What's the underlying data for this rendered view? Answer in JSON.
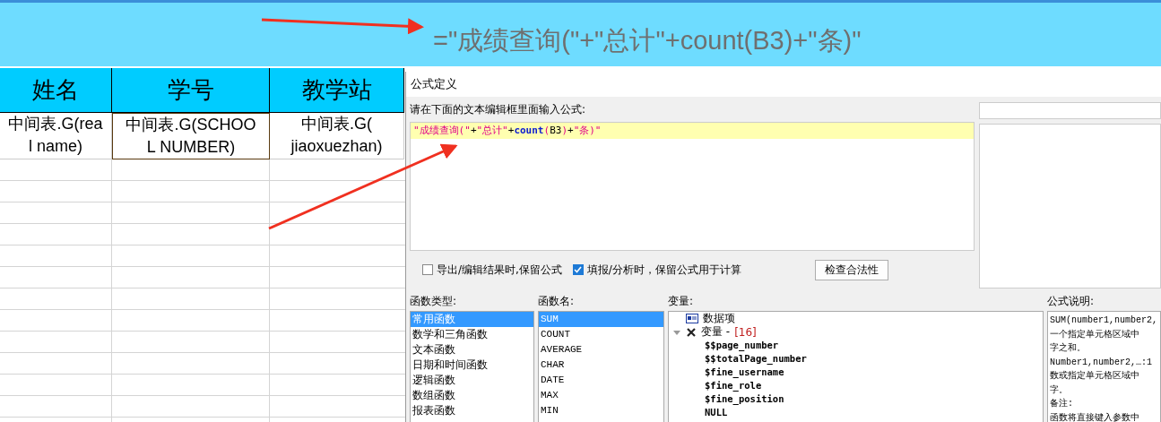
{
  "banner": {
    "formula": "=\"成绩查询(\"+\"总计\"+count(B3)+\"条)\""
  },
  "sheet": {
    "columns": [
      "姓名",
      "学号",
      "教学站"
    ],
    "rows": [
      [
        {
          "text": "中间表.G(rea\nl name)",
          "selected": false
        },
        {
          "text": "中间表.G(SCHOO\nL NUMBER)",
          "selected": true
        },
        {
          "text": "中间表.G(\njiaoxuezhan)",
          "selected": false
        }
      ]
    ]
  },
  "dialog": {
    "title": "公式定义",
    "editor_label": "请在下面的文本编辑框里面输入公式:",
    "formula_tokens": [
      {
        "kind": "string",
        "text": "\"成绩查询(\""
      },
      {
        "kind": "operator",
        "text": "+"
      },
      {
        "kind": "string",
        "text": "\"总计\""
      },
      {
        "kind": "operator",
        "text": "+"
      },
      {
        "kind": "function",
        "text": "count"
      },
      {
        "kind": "paren",
        "text": "("
      },
      {
        "kind": "ref",
        "text": "B3"
      },
      {
        "kind": "paren",
        "text": ")"
      },
      {
        "kind": "operator",
        "text": "+"
      },
      {
        "kind": "string",
        "text": "\"条)\""
      }
    ],
    "options": [
      {
        "label": "导出/编辑结果时,保留公式",
        "checked": false
      },
      {
        "label": "填报/分析时，保留公式用于计算",
        "checked": true
      }
    ],
    "check_button": "检查合法性",
    "function_types": {
      "label": "函数类型:",
      "items": [
        {
          "text": "常用函数",
          "selected": true
        },
        {
          "text": "数学和三角函数",
          "selected": false
        },
        {
          "text": "文本函数",
          "selected": false
        },
        {
          "text": "日期和时间函数",
          "selected": false
        },
        {
          "text": "逻辑函数",
          "selected": false
        },
        {
          "text": "数组函数",
          "selected": false
        },
        {
          "text": "报表函数",
          "selected": false
        }
      ]
    },
    "function_names": {
      "label": "函数名:",
      "items": [
        {
          "text": "SUM",
          "selected": true
        },
        {
          "text": "COUNT",
          "selected": false
        },
        {
          "text": "AVERAGE",
          "selected": false
        },
        {
          "text": "CHAR",
          "selected": false
        },
        {
          "text": "DATE",
          "selected": false
        },
        {
          "text": "MAX",
          "selected": false
        },
        {
          "text": "MIN",
          "selected": false
        }
      ]
    },
    "variables": {
      "label": "变量:",
      "tree": [
        {
          "kind": "dataset",
          "label": "数据项",
          "expanded": false
        },
        {
          "kind": "group",
          "label": "变量 -",
          "count": "[16]",
          "expanded": true,
          "children": [
            {
              "label": "$$page_number"
            },
            {
              "label": "$$totalPage_number"
            },
            {
              "label": "$fine_username"
            },
            {
              "label": "$fine_role"
            },
            {
              "label": "$fine_position"
            },
            {
              "label": "NULL"
            }
          ]
        }
      ]
    },
    "description": {
      "label": "公式说明:",
      "lines": [
        "SUM(number1,number2,",
        "一个指定单元格区域中",
        "字之和。",
        "Number1,number2,…:1",
        "数或指定单元格区域中",
        "字。",
        "备注:",
        "函数将直接键入参数中"
      ]
    }
  }
}
